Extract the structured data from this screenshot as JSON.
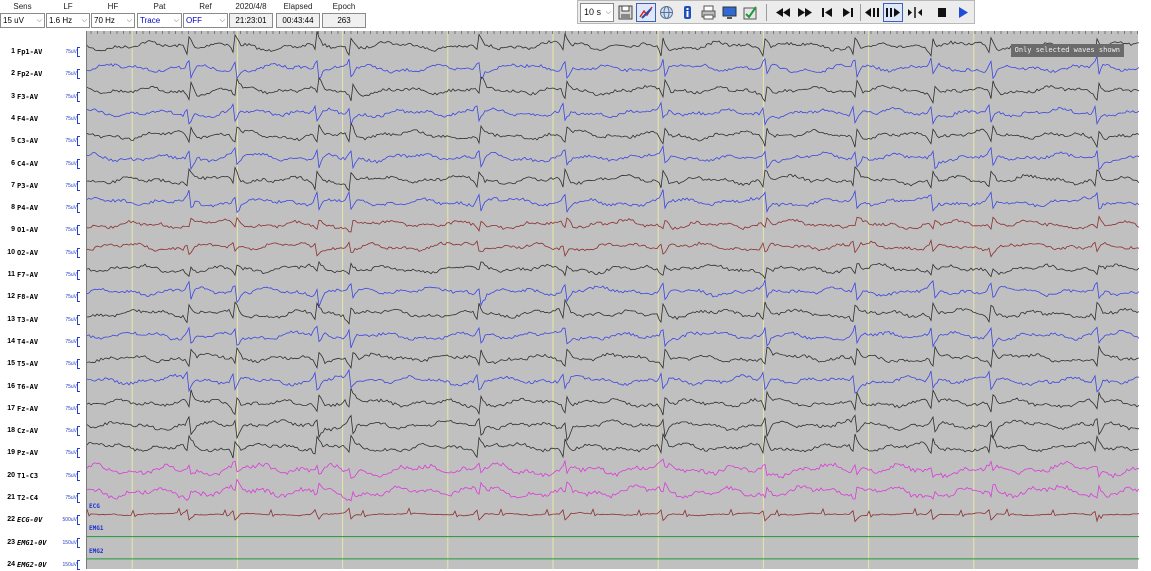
{
  "controls": {
    "sens": {
      "label": "Sens",
      "value": "15 uV"
    },
    "lf": {
      "label": "LF",
      "value": "1.6 Hz"
    },
    "hf": {
      "label": "HF",
      "value": "70 Hz"
    },
    "pat": {
      "label": "Pat",
      "value": "Trace"
    },
    "ref": {
      "label": "Ref",
      "value": "OFF"
    },
    "date": {
      "label": "2020/4/8",
      "value": "21:23:01"
    },
    "elapsed": {
      "label": "Elapsed",
      "value": "00:43:44"
    },
    "epoch": {
      "label": "Epoch",
      "value": "263"
    }
  },
  "toolbar": {
    "timebase": "10 s",
    "icons": [
      "save-icon",
      "edit-chart-icon",
      "globe-icon",
      "info-icon",
      "print-icon",
      "monitor-icon",
      "export-icon"
    ],
    "nav_icons": [
      "fast-rewind-icon",
      "fast-forward-icon",
      "skip-start-icon",
      "skip-end-icon",
      "step-back-icon",
      "step-forward-icon",
      "jump-icon",
      "stop-icon",
      "play-icon"
    ]
  },
  "note": "Only selected waves shown",
  "trace_tags": [
    "ECG",
    "EMG1",
    "EMG2"
  ],
  "channels": [
    {
      "num": "1",
      "name": "Fp1-AV",
      "scale": "75uV",
      "color": "#2e2e2e"
    },
    {
      "num": "2",
      "name": "Fp2-AV",
      "scale": "75uV",
      "color": "#3b46e0"
    },
    {
      "num": "3",
      "name": "F3-AV",
      "scale": "75uV",
      "color": "#2e2e2e"
    },
    {
      "num": "4",
      "name": "F4-AV",
      "scale": "75uV",
      "color": "#3b46e0"
    },
    {
      "num": "5",
      "name": "C3-AV",
      "scale": "75uV",
      "color": "#2e2e2e"
    },
    {
      "num": "6",
      "name": "C4-AV",
      "scale": "75uV",
      "color": "#3b46e0"
    },
    {
      "num": "7",
      "name": "P3-AV",
      "scale": "75uV",
      "color": "#2e2e2e"
    },
    {
      "num": "8",
      "name": "P4-AV",
      "scale": "75uV",
      "color": "#3b46e0"
    },
    {
      "num": "9",
      "name": "O1-AV",
      "scale": "75uV",
      "color": "#8c2f2f"
    },
    {
      "num": "10",
      "name": "O2-AV",
      "scale": "75uV",
      "color": "#8c2f2f"
    },
    {
      "num": "11",
      "name": "F7-AV",
      "scale": "75uV",
      "color": "#2e2e2e"
    },
    {
      "num": "12",
      "name": "F8-AV",
      "scale": "75uV",
      "color": "#3b46e0"
    },
    {
      "num": "13",
      "name": "T3-AV",
      "scale": "75uV",
      "color": "#2e2e2e"
    },
    {
      "num": "14",
      "name": "T4-AV",
      "scale": "75uV",
      "color": "#3b46e0"
    },
    {
      "num": "15",
      "name": "T5-AV",
      "scale": "75uV",
      "color": "#2e2e2e"
    },
    {
      "num": "16",
      "name": "T6-AV",
      "scale": "75uV",
      "color": "#3b46e0"
    },
    {
      "num": "17",
      "name": "Fz-AV",
      "scale": "75uV",
      "color": "#2e2e2e"
    },
    {
      "num": "18",
      "name": "Cz-AV",
      "scale": "75uV",
      "color": "#2e2e2e"
    },
    {
      "num": "19",
      "name": "Pz-AV",
      "scale": "75uV",
      "color": "#2e2e2e"
    },
    {
      "num": "20",
      "name": "T1-C3",
      "scale": "75uV",
      "color": "#d93bd9"
    },
    {
      "num": "21",
      "name": "T2-C4",
      "scale": "75uV",
      "color": "#d93bd9"
    },
    {
      "num": "22",
      "name": "ECG-0V",
      "scale": "500uV",
      "color": "#8c2f2f",
      "italic": true
    },
    {
      "num": "23",
      "name": "EMG1-0V",
      "scale": "150uV",
      "color": "#1e9a3a",
      "italic": true
    },
    {
      "num": "24",
      "name": "EMG2-0V",
      "scale": "150uV",
      "color": "#1e9a3a",
      "italic": true
    }
  ]
}
